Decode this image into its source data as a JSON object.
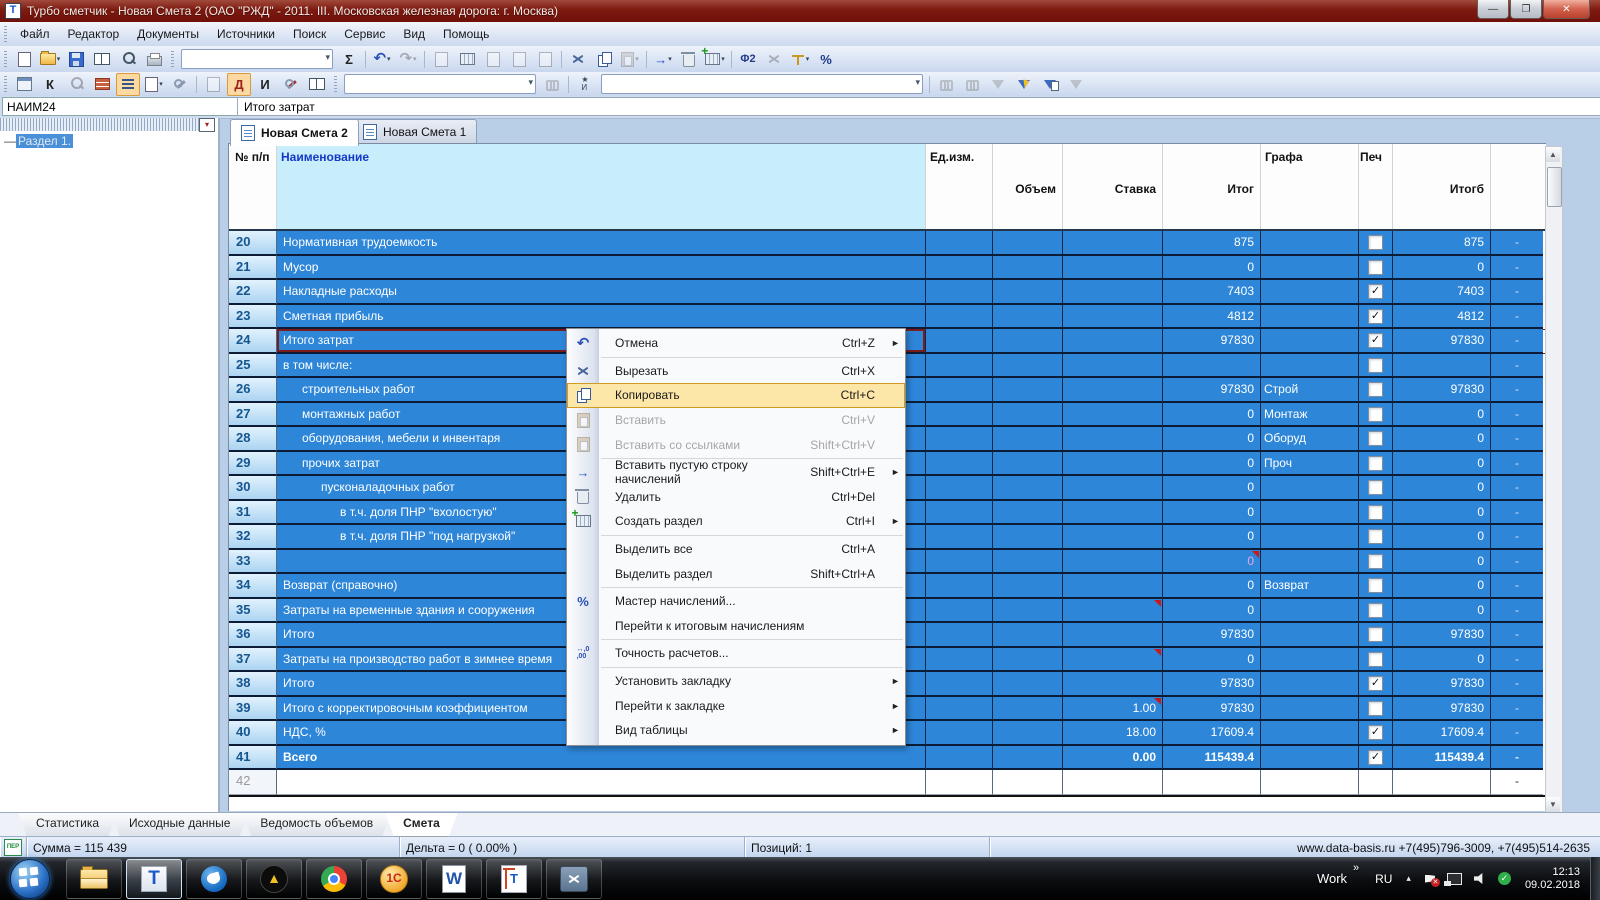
{
  "titlebar": {
    "title": "Турбо сметчик - Новая Смета 2 (ОАО \"РЖД\" - 2011. III. Московская железная дорога: г. Москва)"
  },
  "menubar": {
    "items": [
      "Файл",
      "Редактор",
      "Документы",
      "Источники",
      "Поиск",
      "Сервис",
      "Вид",
      "Помощь"
    ]
  },
  "toolbar": {
    "glyphs": {
      "sigma": "Σ",
      "undo": "↶",
      "redo": "↷",
      "f2": "Φ2",
      "percent": "%",
      "k": "К",
      "d": "Д",
      "i": "И",
      "ai": "А/И",
      "precision": "↔,0\n,00"
    }
  },
  "formulabar": {
    "name_box": "НАИМ24",
    "formula": "Итого затрат"
  },
  "sidebar": {
    "dash": "—",
    "tree_item": "Раздел 1."
  },
  "doc_tabs": [
    {
      "label": "Новая Смета 2",
      "active": true
    },
    {
      "label": "Новая Смета 1",
      "active": false
    }
  ],
  "table": {
    "header": {
      "col_num": "№ п/п",
      "col_name": "Наименование",
      "col_unit": "Ед.изм.",
      "col_volume": "Объем",
      "col_rate": "Ставка",
      "col_total": "Итог",
      "col_grafa": "Графа",
      "col_print": "Печ",
      "col_totalb": "Итогб"
    },
    "rows": [
      {
        "num": "20",
        "name": "Нормативная трудоемкость",
        "indent": 0,
        "rate": "",
        "total": "875",
        "grafa": "",
        "checked": false,
        "totalb": "875",
        "dash": "-"
      },
      {
        "num": "21",
        "name": "Мусор",
        "indent": 0,
        "rate": "",
        "total": "0",
        "grafa": "",
        "checked": false,
        "totalb": "0",
        "dash": "-"
      },
      {
        "num": "22",
        "name": "Накладные расходы",
        "indent": 0,
        "rate": "",
        "total": "7403",
        "grafa": "",
        "checked": true,
        "totalb": "7403",
        "dash": "-"
      },
      {
        "num": "23",
        "name": "Сметная прибыль",
        "indent": 0,
        "rate": "",
        "total": "4812",
        "grafa": "",
        "checked": true,
        "totalb": "4812",
        "dash": "-"
      },
      {
        "num": "24",
        "name": "Итого затрат",
        "indent": 0,
        "rate": "",
        "total": "97830",
        "grafa": "",
        "checked": true,
        "totalb": "97830",
        "dash": "-",
        "selected": true
      },
      {
        "num": "25",
        "name": "в том числе:",
        "indent": 0,
        "rate": "",
        "total": "",
        "grafa": "",
        "checked": false,
        "totalb": "",
        "dash": "-"
      },
      {
        "num": "26",
        "name": "строительных работ",
        "indent": 1,
        "rate": "",
        "total": "97830",
        "grafa": "Строй",
        "checked": false,
        "totalb": "97830",
        "dash": "-"
      },
      {
        "num": "27",
        "name": "монтажных работ",
        "indent": 1,
        "rate": "",
        "total": "0",
        "grafa": "Монтаж",
        "checked": false,
        "totalb": "0",
        "dash": "-"
      },
      {
        "num": "28",
        "name": "оборудования, мебели и инвентаря",
        "indent": 1,
        "rate": "",
        "total": "0",
        "grafa": "Оборуд",
        "checked": false,
        "totalb": "0",
        "dash": "-"
      },
      {
        "num": "29",
        "name": "прочих затрат",
        "indent": 1,
        "rate": "",
        "total": "0",
        "grafa": "Проч",
        "checked": false,
        "totalb": "0",
        "dash": "-"
      },
      {
        "num": "30",
        "name": "пусконаладочных работ",
        "indent": 2,
        "rate": "",
        "total": "0",
        "grafa": "",
        "checked": false,
        "totalb": "0",
        "dash": "-"
      },
      {
        "num": "31",
        "name": "в т.ч. доля ПНР \"вхолостую\"",
        "indent": 3,
        "rate": "",
        "total": "0",
        "grafa": "",
        "checked": false,
        "totalb": "0",
        "dash": "-"
      },
      {
        "num": "32",
        "name": "в т.ч. доля ПНР \"под нагрузкой\"",
        "indent": 3,
        "rate": "",
        "total": "0",
        "grafa": "",
        "checked": false,
        "totalb": "0",
        "dash": "-"
      },
      {
        "num": "33",
        "name": "",
        "indent": 0,
        "rate": "",
        "total": "0",
        "grafa": "",
        "checked": false,
        "totalb": "0",
        "dash": "-",
        "marker": "total",
        "alert": true
      },
      {
        "num": "34",
        "name": "Возврат (справочно)",
        "indent": 0,
        "rate": "",
        "total": "0",
        "grafa": "Возврат",
        "checked": false,
        "totalb": "0",
        "dash": "-"
      },
      {
        "num": "35",
        "name": "Затраты на временные здания и сооружения",
        "indent": 0,
        "rate": "",
        "total": "0",
        "grafa": "",
        "checked": false,
        "totalb": "0",
        "dash": "-",
        "marker": "rate"
      },
      {
        "num": "36",
        "name": "Итого",
        "indent": 0,
        "rate": "",
        "total": "97830",
        "grafa": "",
        "checked": false,
        "totalb": "97830",
        "dash": "-"
      },
      {
        "num": "37",
        "name": "Затраты на производство работ в зимнее время",
        "indent": 0,
        "rate": "",
        "total": "0",
        "grafa": "",
        "checked": false,
        "totalb": "0",
        "dash": "-",
        "marker": "rate"
      },
      {
        "num": "38",
        "name": "Итого",
        "indent": 0,
        "rate": "",
        "total": "97830",
        "grafa": "",
        "checked": true,
        "totalb": "97830",
        "dash": "-"
      },
      {
        "num": "39",
        "name": "Итого с корректировочным коэффициентом",
        "indent": 0,
        "rate": "1.00",
        "total": "97830",
        "grafa": "",
        "checked": false,
        "totalb": "97830",
        "dash": "-",
        "marker": "rate"
      },
      {
        "num": "40",
        "name": "НДС, %",
        "indent": 0,
        "rate": "18.00",
        "total": "17609.4",
        "grafa": "",
        "checked": true,
        "totalb": "17609.4",
        "dash": "-"
      },
      {
        "num": "41",
        "name": "Всего",
        "indent": 0,
        "rate": "0.00",
        "total": "115439.4",
        "grafa": "",
        "checked": true,
        "totalb": "115439.4",
        "dash": "-",
        "bold": true
      },
      {
        "num": "42",
        "name": "",
        "indent": 0,
        "rate": "",
        "total": "",
        "grafa": "",
        "totalb": "",
        "dash": "-",
        "empty_row": true
      }
    ]
  },
  "context_menu": {
    "items": [
      {
        "label": "Отмена",
        "shortcut": "Ctrl+Z",
        "icon": "undo",
        "submenu": true,
        "sep_after": true
      },
      {
        "label": "Вырезать",
        "shortcut": "Ctrl+X",
        "icon": "cut"
      },
      {
        "label": "Копировать",
        "shortcut": "Ctrl+C",
        "icon": "copy",
        "highlighted": true
      },
      {
        "label": "Вставить",
        "shortcut": "Ctrl+V",
        "icon": "paste",
        "disabled": true
      },
      {
        "label": "Вставить со ссылками",
        "shortcut": "Shift+Ctrl+V",
        "icon": "paste-link",
        "disabled": true,
        "sep_after": true
      },
      {
        "label": "Вставить пустую строку начислений",
        "shortcut": "Shift+Ctrl+E",
        "icon": "insert-row",
        "submenu": true
      },
      {
        "label": "Удалить",
        "shortcut": "Ctrl+Del",
        "icon": "trash"
      },
      {
        "label": "Создать раздел",
        "shortcut": "Ctrl+I",
        "icon": "new-section",
        "submenu": true,
        "sep_after": true
      },
      {
        "label": "Выделить все",
        "shortcut": "Ctrl+A"
      },
      {
        "label": "Выделить раздел",
        "shortcut": "Shift+Ctrl+A",
        "sep_after": true
      },
      {
        "label": "Мастер начислений...",
        "icon": "percent"
      },
      {
        "label": "Перейти к итоговым начислениям",
        "sep_after": true
      },
      {
        "label": "Точность расчетов...",
        "icon": "precision",
        "sep_after": true
      },
      {
        "label": "Установить закладку",
        "submenu": true
      },
      {
        "label": "Перейти к закладке",
        "submenu": true
      },
      {
        "label": "Вид таблицы",
        "submenu": true
      }
    ]
  },
  "sheet_tabs": [
    {
      "label": "Статистика",
      "active": false
    },
    {
      "label": "Исходные данные",
      "active": false
    },
    {
      "label": "Ведомость объемов",
      "active": false
    },
    {
      "label": "Смета",
      "active": true
    }
  ],
  "statusbar": {
    "mode": "ПЕР",
    "sum": "Сумма = 115 439",
    "delta": "Дельта = 0 ( 0.00% )",
    "positions": "Позиций: 1",
    "site": "www.data-basis.ru  +7(495)796-3009, +7(495)514-2635"
  },
  "taskbar": {
    "apps": [
      {
        "id": "explorer"
      },
      {
        "id": "turbo",
        "pressed": true
      },
      {
        "id": "tbird"
      },
      {
        "id": "aimp",
        "glyph": "▲"
      },
      {
        "id": "chrome"
      },
      {
        "id": "onec",
        "glyph": "1С"
      },
      {
        "id": "word",
        "glyph": "W"
      },
      {
        "id": "crane",
        "glyph": "T"
      },
      {
        "id": "snip"
      }
    ],
    "tray": {
      "work": "Work",
      "chevron": "»",
      "lang": "RU",
      "up": "▴",
      "flag_x": "✕",
      "check": "✓",
      "time": "12:13",
      "date": "09.02.2018"
    }
  },
  "window_buttons": {
    "minimize": "—",
    "restore": "❐",
    "close": "✕"
  }
}
